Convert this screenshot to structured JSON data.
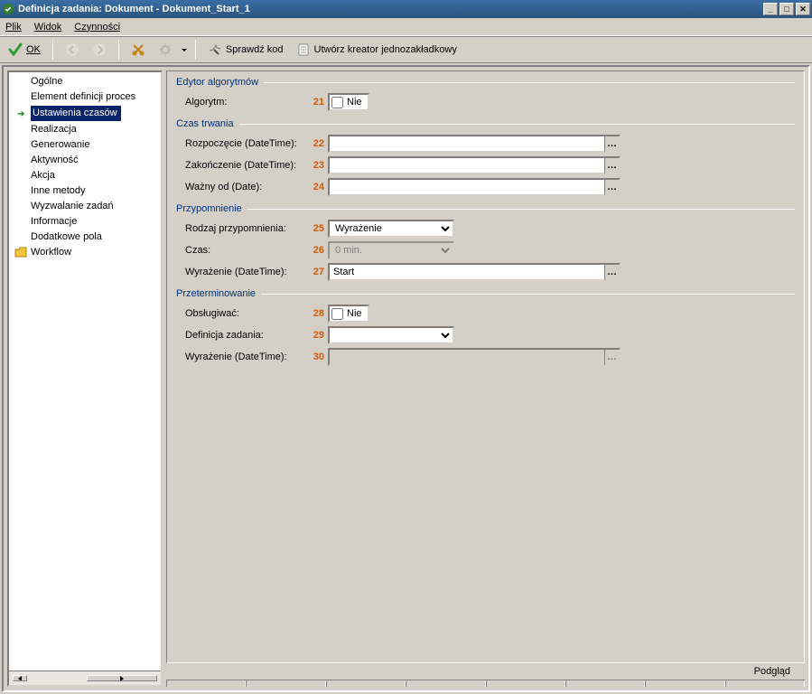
{
  "window": {
    "title": "Definicja zadania: Dokument - Dokument_Start_1"
  },
  "menubar": {
    "items": [
      "Plik",
      "Widok",
      "Czynności"
    ]
  },
  "toolbar": {
    "ok_label": "OK",
    "check_code_label": "Sprawdź kod",
    "create_wizard_label": "Utwórz kreator jednozakładkowy"
  },
  "sidebar": {
    "items": [
      {
        "label": "Ogólne"
      },
      {
        "label": "Element definicji proces"
      },
      {
        "label": "Ustawienia czasów",
        "selected": true,
        "arrow": true
      },
      {
        "label": "Realizacja"
      },
      {
        "label": "Generowanie"
      },
      {
        "label": "Aktywność"
      },
      {
        "label": "Akcja"
      },
      {
        "label": "Inne metody"
      },
      {
        "label": "Wyzwalanie zadań"
      },
      {
        "label": "Informacje"
      },
      {
        "label": "Dodatkowe pola"
      }
    ],
    "folder_item": {
      "label": "Workflow"
    }
  },
  "form": {
    "group_editor": {
      "title": "Edytor algorytmów",
      "algorithm_label": "Algorytm:",
      "algorithm_num": "21",
      "algorithm_check_label": "Nie"
    },
    "group_duration": {
      "title": "Czas trwania",
      "start_label": "Rozpoczęcie (DateTime):",
      "start_num": "22",
      "start_value": "",
      "end_label": "Zakończenie (DateTime):",
      "end_num": "23",
      "end_value": "",
      "valid_label": "Ważny od (Date):",
      "valid_num": "24",
      "valid_value": ""
    },
    "group_reminder": {
      "title": "Przypomnienie",
      "kind_label": "Rodzaj przypomnienia:",
      "kind_num": "25",
      "kind_value": "Wyrażenie",
      "time_label": "Czas:",
      "time_num": "26",
      "time_value": "0 min.",
      "expr_label": "Wyrażenie (DateTime):",
      "expr_num": "27",
      "expr_value": "Start"
    },
    "group_overdue": {
      "title": "Przeterminowanie",
      "handle_label": "Obsługiwać:",
      "handle_num": "28",
      "handle_check_label": "Nie",
      "taskdef_label": "Definicja zadania:",
      "taskdef_num": "29",
      "taskdef_value": "",
      "expr_label": "Wyrażenie (DateTime):",
      "expr_num": "30",
      "expr_value": ""
    }
  },
  "status": {
    "preview_label": "Podgląd"
  }
}
